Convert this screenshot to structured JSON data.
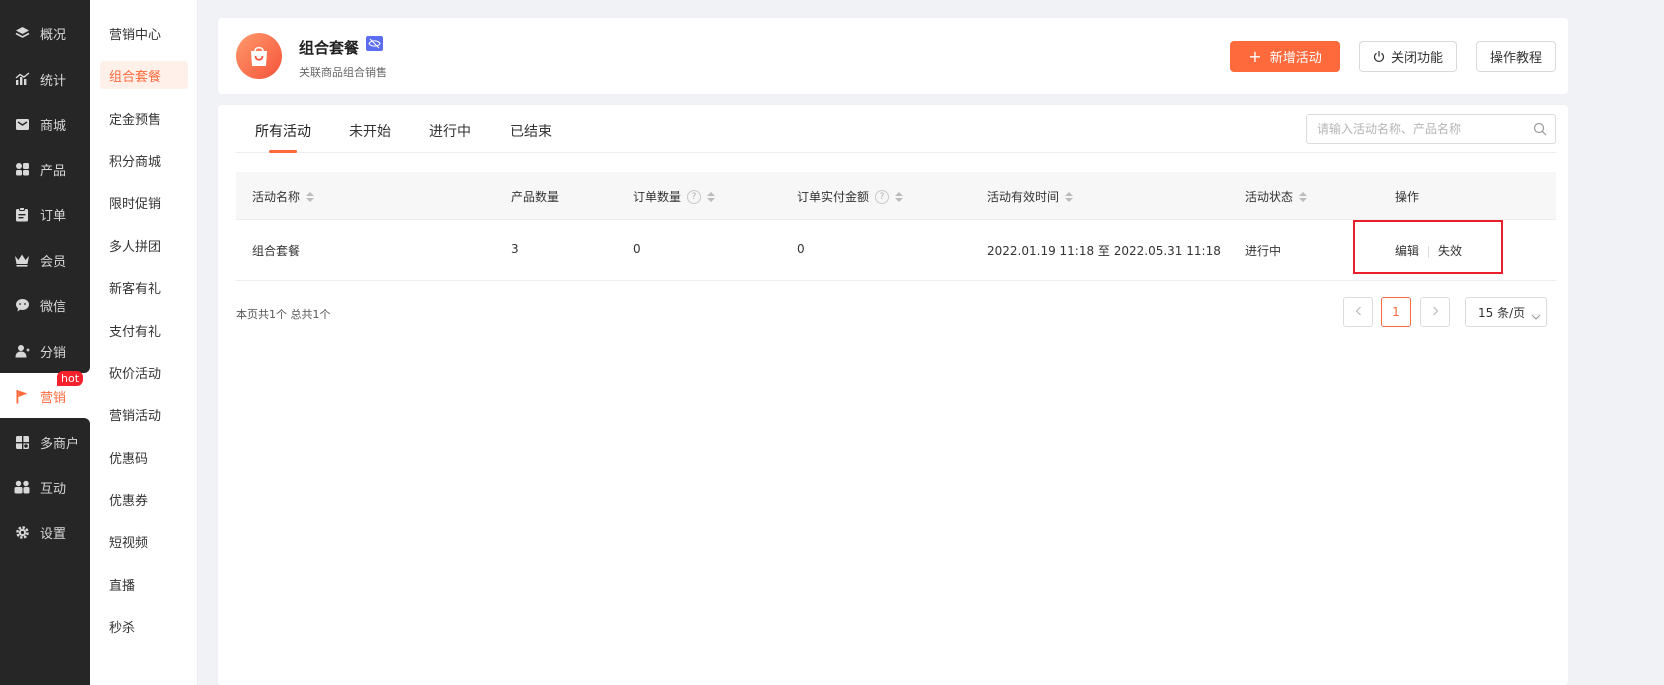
{
  "nav": {
    "items": [
      {
        "label": "概况",
        "icon": "layers-icon"
      },
      {
        "label": "统计",
        "icon": "chart-icon"
      },
      {
        "label": "商城",
        "icon": "mail-icon"
      },
      {
        "label": "产品",
        "icon": "grid-icon"
      },
      {
        "label": "订单",
        "icon": "clipboard-icon"
      },
      {
        "label": "会员",
        "icon": "crown-icon"
      },
      {
        "label": "微信",
        "icon": "chat-icon"
      },
      {
        "label": "分销",
        "icon": "user-icon"
      },
      {
        "label": "营销",
        "icon": "flag-icon"
      },
      {
        "label": "多商户",
        "icon": "store-icon"
      },
      {
        "label": "互动",
        "icon": "users-icon"
      },
      {
        "label": "设置",
        "icon": "gear-icon"
      }
    ],
    "hot_badge": "hot",
    "active_index": 8
  },
  "subnav": {
    "items": [
      "营销中心",
      "组合套餐",
      "定金预售",
      "积分商城",
      "限时促销",
      "多人拼团",
      "新客有礼",
      "支付有礼",
      "砍价活动",
      "营销活动",
      "优惠码",
      "优惠券",
      "短视频",
      "直播",
      "秒杀"
    ],
    "active_index": 1
  },
  "header": {
    "title": "组合套餐",
    "subtitle": "关联商品组合销售",
    "add_button": "新增活动",
    "close_button": "关闭功能",
    "tutorial_button": "操作教程"
  },
  "tabs": {
    "items": [
      "所有活动",
      "未开始",
      "进行中",
      "已结束"
    ],
    "active_index": 0
  },
  "search": {
    "placeholder": "请输入活动名称、产品名称",
    "value": ""
  },
  "table": {
    "columns": [
      "活动名称",
      "产品数量",
      "订单数量",
      "订单实付金额",
      "活动有效时间",
      "活动状态",
      "操作"
    ],
    "rows": [
      {
        "name": "组合套餐",
        "product_count": "3",
        "order_count": "0",
        "paid_amount": "0",
        "valid_time": "2022.01.19 11:18 至 2022.05.31 11:18",
        "status": "进行中",
        "actions": [
          "编辑",
          "失效"
        ]
      }
    ]
  },
  "pagination": {
    "summary": "本页共1个 总共1个",
    "current_page": "1",
    "page_size": "15 条/页"
  },
  "colors": {
    "accent": "#ff6a3d",
    "nav_bg": "#262626",
    "highlight": "#e8202a"
  }
}
